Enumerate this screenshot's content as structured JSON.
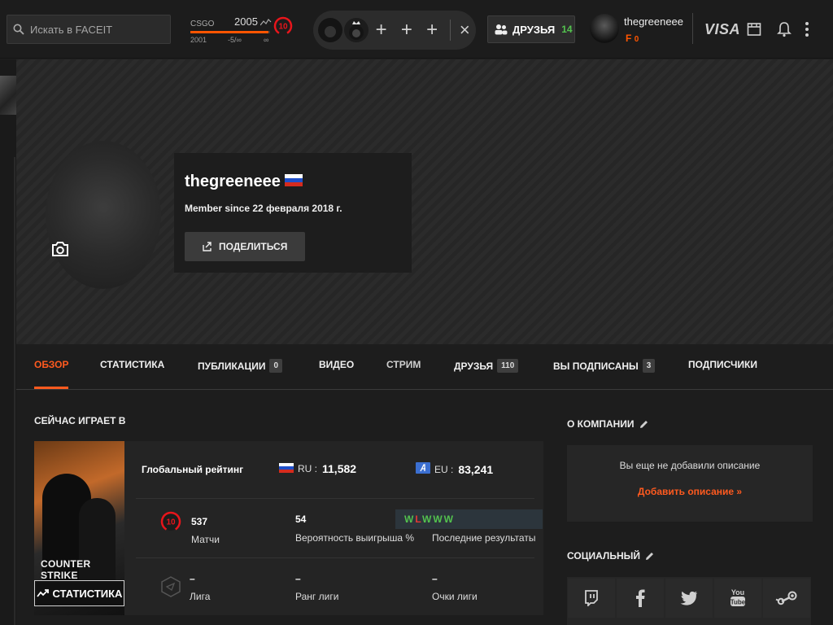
{
  "search": {
    "placeholder": "Искать в FACEIT"
  },
  "elo": {
    "game": "CSGO",
    "value": "2005",
    "bar_progress": 0.98,
    "left": "2001",
    "mid": "-5/∞",
    "right": "∞",
    "level": "10"
  },
  "party": {
    "close": "×"
  },
  "friends_button": {
    "label": "ДРУЗЬЯ",
    "count": "14"
  },
  "user": {
    "name": "thegreeneee",
    "points": "0",
    "points_icon": "F"
  },
  "header": {
    "visa": "VISA"
  },
  "profile": {
    "name": "thegreeneee",
    "member_since": "Member since 22 февраля 2018 г.",
    "share_label": "ПОДЕЛИТЬСЯ"
  },
  "tabs": [
    {
      "label": "ОБЗОР",
      "badge": ""
    },
    {
      "label": "СТАТИСТИКА",
      "badge": ""
    },
    {
      "label": "ПУБЛИКАЦИИ",
      "badge": "0"
    },
    {
      "label": "ВИДЕО",
      "badge": ""
    },
    {
      "label": "СТРИМ",
      "badge": ""
    },
    {
      "label": "ДРУЗЬЯ",
      "badge": "110"
    },
    {
      "label": "ВЫ ПОДПИСАНЫ",
      "badge": "3"
    },
    {
      "label": "ПОДПИСЧИКИ",
      "badge": ""
    }
  ],
  "now_playing": {
    "title": "СЕЙЧАС ИГРАЕТ В",
    "game_logo": "COUNTER STRIKE",
    "stats_button": "СТАТИСТИКА",
    "global_rating_label": "Глобальный рейтинг",
    "rank_ru": {
      "region": "RU :",
      "value": "11,582"
    },
    "rank_eu": {
      "region": "EU :",
      "value": "83,241"
    },
    "matches": {
      "value": "537",
      "label": "Матчи",
      "level": "10"
    },
    "win_rate": {
      "value": "54",
      "label": "Вероятность выигрыша %"
    },
    "recent": {
      "results": [
        "W",
        "L",
        "W",
        "W",
        "W"
      ],
      "label": "Последние результаты"
    },
    "league": {
      "value": "–",
      "label": "Лига"
    },
    "league_rank": {
      "value": "–",
      "label": "Ранг лиги"
    },
    "league_points": {
      "value": "–",
      "label": "Очки лиги"
    }
  },
  "about": {
    "title": "О КОМПАНИИ",
    "empty": "Вы еще не добавили описание",
    "add": "Добавить описание »"
  },
  "social": {
    "title": "СОЦИАЛЬНЫЙ",
    "icons": [
      "twitch-icon",
      "facebook-icon",
      "twitter-icon",
      "youtube-icon",
      "steam-icon"
    ]
  },
  "colors": {
    "accent": "#ff5500",
    "win": "#53c24e",
    "loss": "#e53935"
  }
}
